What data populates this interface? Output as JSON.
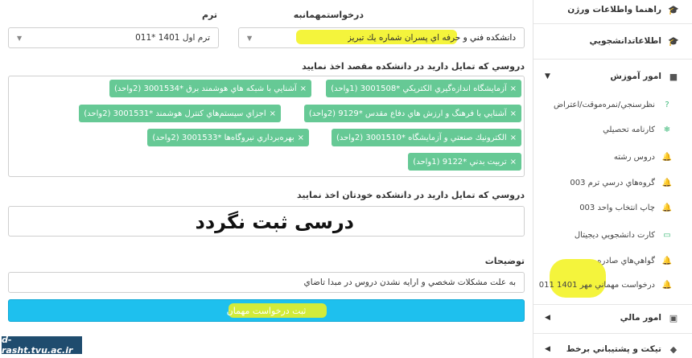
{
  "form": {
    "host_request_label": "درخواستمهمانبه",
    "host_select_value": "دانشكده فني و حرفه اي پسران شماره يك تبريز",
    "term_label": "ترم",
    "term_select_value": "ترم اول 1401 *011",
    "dest_courses_label": "دروسي كه تمايل داريد در دانشكده مقصد اخذ نماييد",
    "dest_courses": [
      "آزمايشگاه اندازه‌گيري الكتريكي *3001508 (1واحد)",
      "آشنايي با شبكه هاي هوشمند برق *3001534 (2واحد)",
      "آشنايي با فرهنگ و ارزش هاي دفاع مقدس *9129 (2واحد)",
      "اجزاي سيستم‌هاي كنترل هوشمند *3001531 (2واحد)",
      "الكترونيك صنعتي و آزمايشگاه *3001510 (2واحد)",
      "بهره‌برداري نيروگاه‌ها *3001533 (2واحد)",
      "تربيت بدني *9122 (1واحد)"
    ],
    "tag_remove_symbol": "×",
    "own_courses_label": "دروسي كه تمايل داريد در دانشكده خودتان اخذ نماييد",
    "overlay_note": "درسی  ثبت نگردد",
    "description_label": "توضيحات",
    "description_value": "به علت مشكلات شخصي و ارايه نشدن دروس در مبدا تاضاي",
    "submit_label": "ثبت درخواست مهمان"
  },
  "sidebar": {
    "items": [
      {
        "label": "راهنما واطلاعات ورژن",
        "icon": "graduation-cap-icon"
      },
      {
        "label": "اطلاعاتدانشجويي",
        "icon": "graduation-cap-icon"
      },
      {
        "label": "امور آموزش",
        "icon": "book-icon"
      },
      {
        "label": "امور مالي",
        "icon": "wallet-icon"
      },
      {
        "label": "تيكت و پشتيباني برخط",
        "icon": "tag-icon"
      }
    ],
    "sub_items": [
      {
        "label": "نظرسنجي/نمره‌موقت/اعتراض",
        "icon": "question-icon"
      },
      {
        "label": "كارنامه تحصيلي",
        "icon": "snowflake-icon"
      },
      {
        "label": "دروس رشته",
        "icon": "bell-icon"
      },
      {
        "label": "گروه‌هاي درسي ترم 003",
        "icon": "bell-icon"
      },
      {
        "label": "چاپ انتخاب واحد 003",
        "icon": "bell-icon"
      },
      {
        "label": "كارت دانشجويي ديجيتال",
        "icon": "card-icon"
      },
      {
        "label": "گواهي‌هاي صادره",
        "icon": "bell-icon"
      },
      {
        "label": "درخواست مهماني مهر 1401 011",
        "icon": "bell-icon"
      }
    ]
  },
  "watermark": "d-rasht.tvu.ac.ir",
  "colors": {
    "tag": "#66c995",
    "submit": "#1ec0ee",
    "highlight": "#f2f21a"
  }
}
